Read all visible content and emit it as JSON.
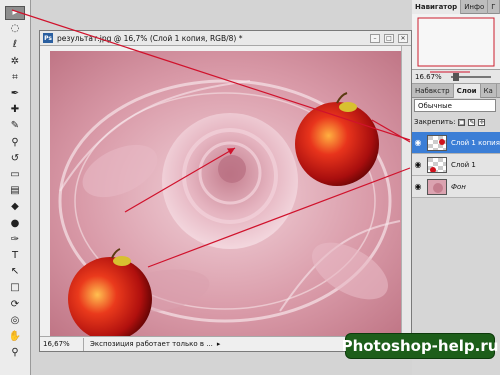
{
  "document": {
    "title": "результат.jpg @ 16,7% (Слой 1 копия, RGB/8) *",
    "app_badge": "Ps",
    "controls": [
      "–",
      "□",
      "✕"
    ],
    "zoom": "16,67%",
    "status_message": "Экспозиция работает только в ...",
    "status_arrow": "▸"
  },
  "tools": [
    {
      "name": "move-tool",
      "glyph": "▸"
    },
    {
      "name": "marquee-tool",
      "glyph": "◌"
    },
    {
      "name": "lasso-tool",
      "glyph": "ℓ"
    },
    {
      "name": "magic-wand-tool",
      "glyph": "✲"
    },
    {
      "name": "crop-tool",
      "glyph": "⌗"
    },
    {
      "name": "eyedropper-tool",
      "glyph": "✒"
    },
    {
      "name": "healing-brush-tool",
      "glyph": "✚"
    },
    {
      "name": "brush-tool",
      "glyph": "✎"
    },
    {
      "name": "clone-stamp-tool",
      "glyph": "⚲"
    },
    {
      "name": "history-brush-tool",
      "glyph": "↺"
    },
    {
      "name": "eraser-tool",
      "glyph": "▭"
    },
    {
      "name": "gradient-tool",
      "glyph": "▤"
    },
    {
      "name": "blur-tool",
      "glyph": "◆"
    },
    {
      "name": "dodge-tool",
      "glyph": "●"
    },
    {
      "name": "pen-tool",
      "glyph": "✑"
    },
    {
      "name": "type-tool",
      "glyph": "T"
    },
    {
      "name": "path-selection-tool",
      "glyph": "↖"
    },
    {
      "name": "shape-tool",
      "glyph": "□"
    },
    {
      "name": "3d-rotate-tool",
      "glyph": "⟳"
    },
    {
      "name": "3d-orbit-tool",
      "glyph": "◎"
    },
    {
      "name": "hand-tool",
      "glyph": "✋"
    },
    {
      "name": "zoom-tool",
      "glyph": "⚲"
    }
  ],
  "navigator": {
    "tabs": [
      "Навигатор",
      "Инфо",
      "Г"
    ],
    "zoom": "16.67%"
  },
  "layers_panel": {
    "tabs": [
      "Набвкстр",
      "Слои",
      "Ка"
    ],
    "blend_mode": "Обычные",
    "lock_label": "Закрепить:",
    "lock_icons": [
      "□",
      "✎",
      "✛"
    ],
    "layers": [
      {
        "name": "Слой 1 копия",
        "selected": true
      },
      {
        "name": "Слой 1",
        "selected": false
      },
      {
        "name": "Фон",
        "selected": false
      }
    ]
  },
  "watermark": "Photoshop-help.ru",
  "colors": {
    "arrow": "#d0122c",
    "selection": "#3b7ed6",
    "watermark_bg": "#1d5e1a"
  }
}
